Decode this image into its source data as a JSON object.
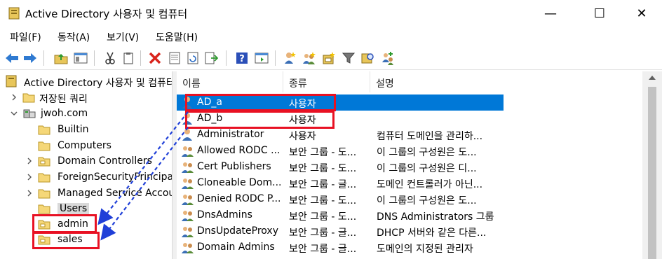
{
  "window": {
    "title": "Active Directory 사용자 및 컴퓨터",
    "minimize": "—",
    "maximize": "☐",
    "close": "✕"
  },
  "menu": [
    "파일(F)",
    "동작(A)",
    "보기(V)",
    "도움말(H)"
  ],
  "toolbar_icons": [
    "back-arrow-icon",
    "forward-arrow-icon",
    "up-folder-icon",
    "show-console-tree-icon",
    "cut-icon",
    "copy-icon",
    "delete-icon",
    "properties-icon",
    "refresh-icon",
    "export-list-icon",
    "help-icon",
    "view-icon",
    "new-user-icon",
    "new-group-icon",
    "new-ou-icon",
    "filter-icon",
    "find-icon",
    "add-to-group-icon"
  ],
  "tree": {
    "root": "Active Directory 사용자 및 컴퓨터",
    "saved_queries": "저장된 쿼리",
    "domain": "jwoh.com",
    "children": [
      "Builtin",
      "Computers",
      "Domain Controllers",
      "ForeignSecurityPrincipals",
      "Managed Service Accounts",
      "Users",
      "admin",
      "sales"
    ]
  },
  "list": {
    "columns": [
      "이름",
      "종류",
      "설명"
    ],
    "rows": [
      {
        "name": "AD_a",
        "type": "사용자",
        "desc": ""
      },
      {
        "name": "AD_b",
        "type": "사용자",
        "desc": ""
      },
      {
        "name": "Administrator",
        "type": "사용자",
        "desc": "컴퓨터 도메인을 관리하..."
      },
      {
        "name": "Allowed RODC ...",
        "type": "보안 그룹 - 도...",
        "desc": "이 그룹의 구성원은 도..."
      },
      {
        "name": "Cert Publishers",
        "type": "보안 그룹 - 도...",
        "desc": "이 그룹의 구성원은 디..."
      },
      {
        "name": "Cloneable Dom...",
        "type": "보안 그룹 - 글...",
        "desc": "도메인 컨트롤러가 아닌..."
      },
      {
        "name": "Denied RODC P...",
        "type": "보안 그룹 - 도...",
        "desc": "이 그룹의 구성원은 도..."
      },
      {
        "name": "DnsAdmins",
        "type": "보안 그룹 - 도...",
        "desc": "DNS Administrators 그룹"
      },
      {
        "name": "DnsUpdateProxy",
        "type": "보안 그룹 - 글...",
        "desc": "DHCP 서버와 같은 다른..."
      },
      {
        "name": "Domain Admins",
        "type": "보안 그룹 - 글...",
        "desc": "도메인의 지정된 관리자"
      }
    ]
  },
  "colors": {
    "selection": "#0078d7",
    "highlight_box": "#e81123",
    "arrow": "#1f3fd8",
    "folder": "#f5d778"
  }
}
